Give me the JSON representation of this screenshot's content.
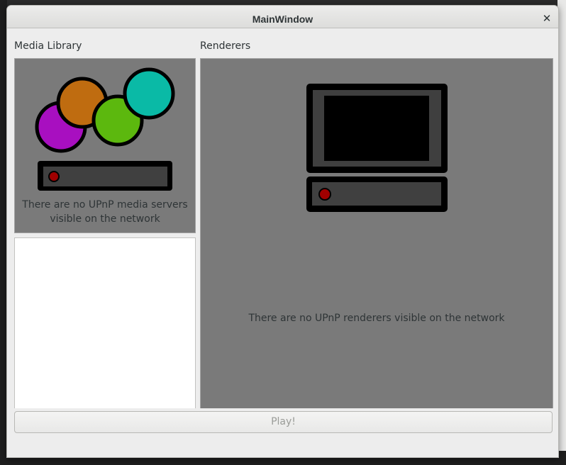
{
  "window": {
    "title": "MainWindow",
    "close_glyph": "✕"
  },
  "media_library": {
    "label": "Media Library",
    "empty_message_line1": "There are no UPnP media servers",
    "empty_message_line2": "visible on the network",
    "illustration": "media-server-icon",
    "circle_colors": [
      "#a80fc0",
      "#bf6c10",
      "#5cb80e",
      "#0abaa6"
    ],
    "led_color": "#a00000"
  },
  "renderers": {
    "label": "Renderers",
    "empty_message": "There are no UPnP renderers visible on the network",
    "illustration": "renderer-tv-icon",
    "led_color": "#a00000"
  },
  "play_button": {
    "label": "Play!",
    "enabled": false
  },
  "colors": {
    "panel_bg": "#7a7a7a",
    "window_bg": "#ededed"
  }
}
